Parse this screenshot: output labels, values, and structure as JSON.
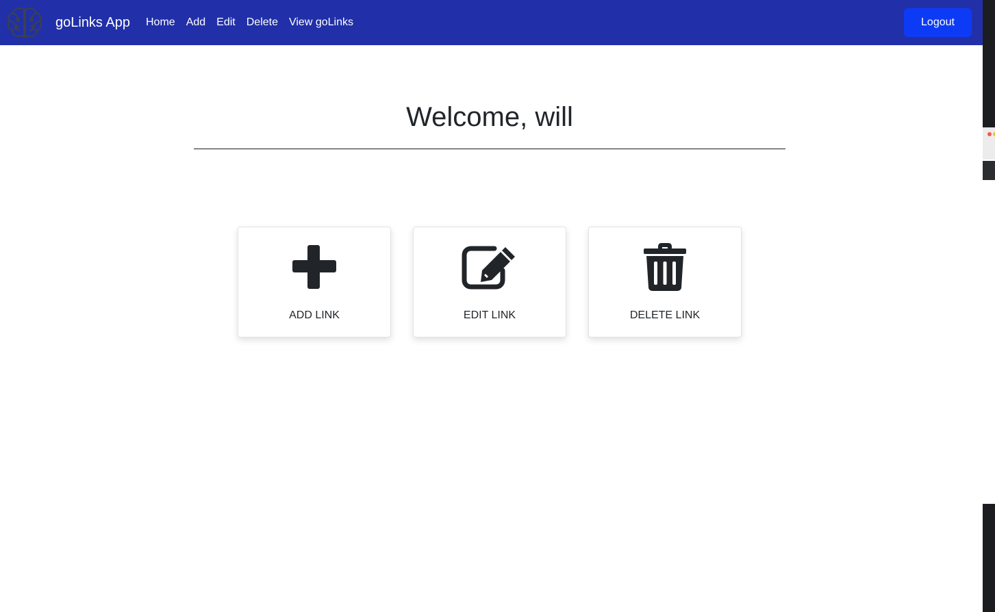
{
  "navbar": {
    "brand": "goLinks App",
    "links": [
      "Home",
      "Add",
      "Edit",
      "Delete",
      "View goLinks"
    ],
    "logout_label": "Logout",
    "background_color": "#2130a8",
    "logout_color": "#0d3bf5",
    "logo_icon": "brain-icon"
  },
  "main": {
    "welcome": "Welcome, will",
    "cards": [
      {
        "label": "ADD LINK",
        "icon": "plus-icon"
      },
      {
        "label": "EDIT LINK",
        "icon": "edit-icon"
      },
      {
        "label": "DELETE LINK",
        "icon": "trash-icon"
      }
    ]
  }
}
